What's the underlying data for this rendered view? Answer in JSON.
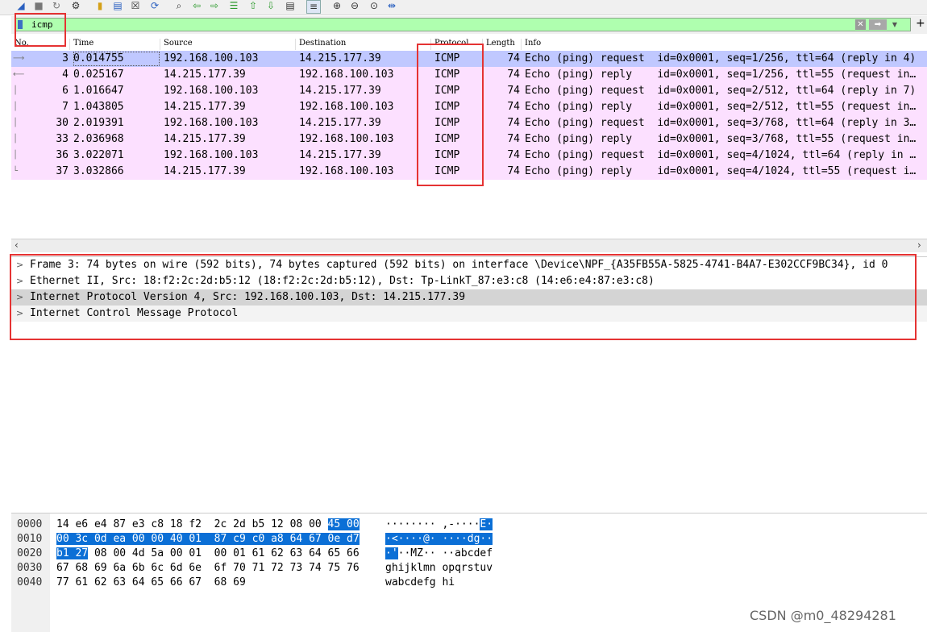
{
  "toolbar": {
    "icons": [
      "shark-fin-start-icon",
      "stop-icon",
      "restart-icon",
      "options-icon",
      "open-file-icon",
      "save-file-icon",
      "close-file-icon",
      "reload-icon",
      "find-icon",
      "back-icon",
      "forward-icon",
      "goto-icon",
      "first-icon",
      "last-icon",
      "autoscroll-icon",
      "colorize-icon",
      "zoom-in-icon",
      "zoom-out-icon",
      "zoom-normal-icon",
      "resize-columns-icon"
    ]
  },
  "filter": {
    "value": "icmp"
  },
  "packet_list": {
    "columns": [
      "No.",
      "Time",
      "Source",
      "Destination",
      "Protocol",
      "Length",
      "Info"
    ],
    "rows": [
      {
        "no": "3",
        "time": "0.014755",
        "src": "192.168.100.103",
        "dst": "14.215.177.39",
        "proto": "ICMP",
        "len": "74",
        "info": "Echo (ping) request  id=0x0001, seq=1/256, ttl=64 (reply in 4)",
        "selected": true
      },
      {
        "no": "4",
        "time": "0.025167",
        "src": "14.215.177.39",
        "dst": "192.168.100.103",
        "proto": "ICMP",
        "len": "74",
        "info": "Echo (ping) reply    id=0x0001, seq=1/256, ttl=55 (request in…"
      },
      {
        "no": "6",
        "time": "1.016647",
        "src": "192.168.100.103",
        "dst": "14.215.177.39",
        "proto": "ICMP",
        "len": "74",
        "info": "Echo (ping) request  id=0x0001, seq=2/512, ttl=64 (reply in 7)"
      },
      {
        "no": "7",
        "time": "1.043805",
        "src": "14.215.177.39",
        "dst": "192.168.100.103",
        "proto": "ICMP",
        "len": "74",
        "info": "Echo (ping) reply    id=0x0001, seq=2/512, ttl=55 (request in…"
      },
      {
        "no": "30",
        "time": "2.019391",
        "src": "192.168.100.103",
        "dst": "14.215.177.39",
        "proto": "ICMP",
        "len": "74",
        "info": "Echo (ping) request  id=0x0001, seq=3/768, ttl=64 (reply in 3…"
      },
      {
        "no": "33",
        "time": "2.036968",
        "src": "14.215.177.39",
        "dst": "192.168.100.103",
        "proto": "ICMP",
        "len": "74",
        "info": "Echo (ping) reply    id=0x0001, seq=3/768, ttl=55 (request in…"
      },
      {
        "no": "36",
        "time": "3.022071",
        "src": "192.168.100.103",
        "dst": "14.215.177.39",
        "proto": "ICMP",
        "len": "74",
        "info": "Echo (ping) request  id=0x0001, seq=4/1024, ttl=64 (reply in …"
      },
      {
        "no": "37",
        "time": "3.032866",
        "src": "14.215.177.39",
        "dst": "192.168.100.103",
        "proto": "ICMP",
        "len": "74",
        "info": "Echo (ping) reply    id=0x0001, seq=4/1024, ttl=55 (request i…"
      }
    ]
  },
  "details": [
    "Frame 3: 74 bytes on wire (592 bits), 74 bytes captured (592 bits) on interface \\Device\\NPF_{A35FB55A-5825-4741-B4A7-E302CCF9BC34}, id 0",
    "Ethernet II, Src: 18:f2:2c:2d:b5:12 (18:f2:2c:2d:b5:12), Dst: Tp-LinkT_87:e3:c8 (14:e6:e4:87:e3:c8)",
    "Internet Protocol Version 4, Src: 192.168.100.103, Dst: 14.215.177.39",
    "Internet Control Message Protocol"
  ],
  "bytes": [
    {
      "offset": "0000",
      "hex_plain": "14 e6 e4 87 e3 c8 18 f2  2c 2d b5 12 08 00 ",
      "hex_hl": "45 00",
      "hex_tail": "",
      "asc_plain": "········ ,-····",
      "asc_hl": "E·",
      "asc_tail": ""
    },
    {
      "offset": "0010",
      "hex_plain": "",
      "hex_hl": "00 3c 0d ea 00 00 40 01  87 c9 c0 a8 64 67 0e d7",
      "hex_tail": "",
      "asc_plain": "",
      "asc_hl": "·<····@· ····dg··",
      "asc_tail": ""
    },
    {
      "offset": "0020",
      "hex_plain": "",
      "hex_hl": "b1 27",
      "hex_tail": " 08 00 4d 5a 00 01  00 01 61 62 63 64 65 66",
      "asc_plain": "",
      "asc_hl": "·'",
      "asc_tail": "··MZ·· ··abcdef"
    },
    {
      "offset": "0030",
      "hex_plain": "67 68 69 6a 6b 6c 6d 6e  6f 70 71 72 73 74 75 76",
      "hex_hl": "",
      "hex_tail": "",
      "asc_plain": "ghijklmn opqrstuv",
      "asc_hl": "",
      "asc_tail": ""
    },
    {
      "offset": "0040",
      "hex_plain": "77 61 62 63 64 65 66 67  68 69",
      "hex_hl": "",
      "hex_tail": "",
      "asc_plain": "wabcdefg hi",
      "asc_hl": "",
      "asc_tail": ""
    }
  ],
  "watermark": "CSDN @m0_48294281",
  "colors": {
    "accent": "#e53333",
    "selected_row": "#c0c8ff",
    "icmp_row": "#fce0ff",
    "filter_ok": "#afffaf",
    "byte_highlight": "#0b6fd6"
  }
}
